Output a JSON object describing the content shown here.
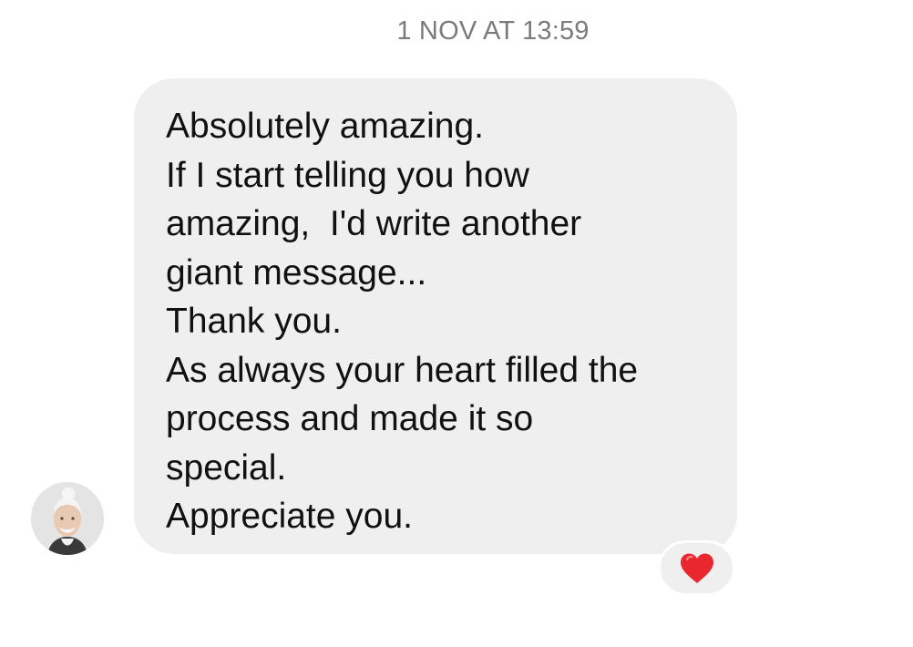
{
  "timestamp": "1 NOV AT 13:59",
  "message": {
    "lines": [
      "Absolutely amazing.",
      "If I start telling you how",
      "amazing,  I'd write another",
      "giant message...",
      "Thank you.",
      "As always your heart filled the",
      "process and made it so",
      "special.",
      "Appreciate you."
    ]
  },
  "sender": {
    "avatar_icon": "avatar-icon"
  },
  "reaction": {
    "icon": "heart-icon",
    "color": "#e8282e"
  },
  "colors": {
    "bubble": "#efefef",
    "timestamp": "#7b7b7b",
    "text": "#111111",
    "heart": "#e8282e"
  }
}
